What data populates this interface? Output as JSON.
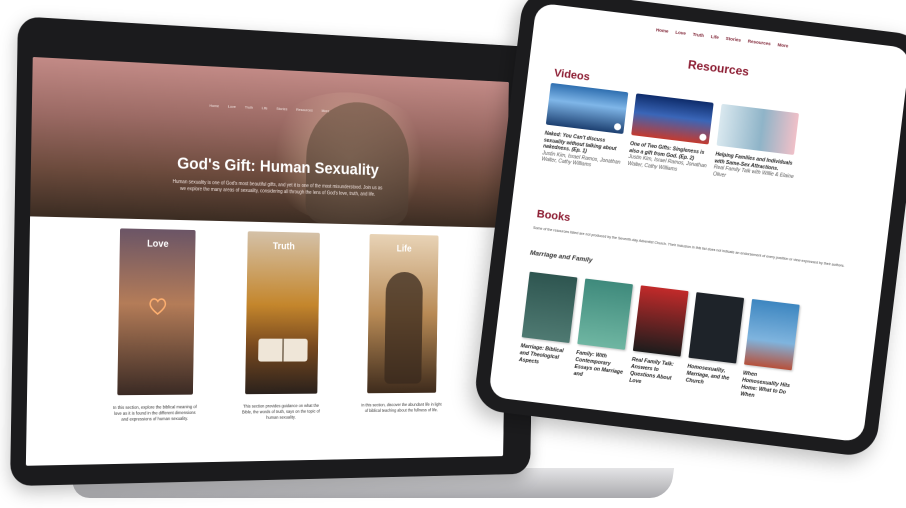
{
  "laptop": {
    "nav": [
      "Home",
      "Love",
      "Truth",
      "Life",
      "Stories",
      "Resources",
      "More"
    ],
    "hero_title": "God's Gift: Human Sexuality",
    "hero_sub": "Human sexuality is one of God's most beautiful gifts, and yet it is one of the most misunderstood. Join us as we explore the many areas of sexuality, considering all through the lens of God's love, truth, and life.",
    "cards": [
      {
        "title": "Love",
        "desc": "In this section, explore the biblical meaning of love as it is found in the different dimensions and expressions of human sexuality."
      },
      {
        "title": "Truth",
        "desc": "This section provides guidance on what the Bible, the words of truth, says on the topic of human sexuality."
      },
      {
        "title": "Life",
        "desc": "In this section, discover the abundant life in light of biblical teaching about the fullness of life."
      }
    ]
  },
  "tablet": {
    "nav": [
      "Home",
      "Love",
      "Truth",
      "Life",
      "Stories",
      "Resources",
      "More"
    ],
    "page_title": "Resources",
    "videos_heading": "Videos",
    "videos": [
      {
        "title": "Naked: You Can't discuss sexuality without talking about nakedness. (Ep. 1)",
        "people": "Justin Kim, Israel Ramos, Jonathan Walter, Cathy Williams"
      },
      {
        "title": "One of Two Gifts: Singleness is also a gift from God. (Ep. 2)",
        "people": "Justin Kim, Israel Ramos, Jonathan Walter, Cathy Williams"
      },
      {
        "title": "Helping Families and Individuals with Same-Sex Attractions.",
        "people": "Real Family Talk with Willie & Elaine Oliver"
      }
    ],
    "books_heading": "Books",
    "books_note": "Some of the resources listed are not produced by the Seventh-day Adventist Church. Their inclusion in this list does not indicate an endorsement of every position or view expressed by their authors.",
    "category": "Marriage and Family",
    "books": [
      "Marriage: Biblical and Theological Aspects",
      "Family: With Contemporary Essays on Marriage and",
      "Real Family Talk: Answers to Questions About Love",
      "Homosexuality, Marriage, and the Church",
      "When Homosexuality Hits Home: What to Do When"
    ]
  },
  "colors": {
    "accent": "#8c1c32",
    "nav": "#7b1d2f"
  }
}
